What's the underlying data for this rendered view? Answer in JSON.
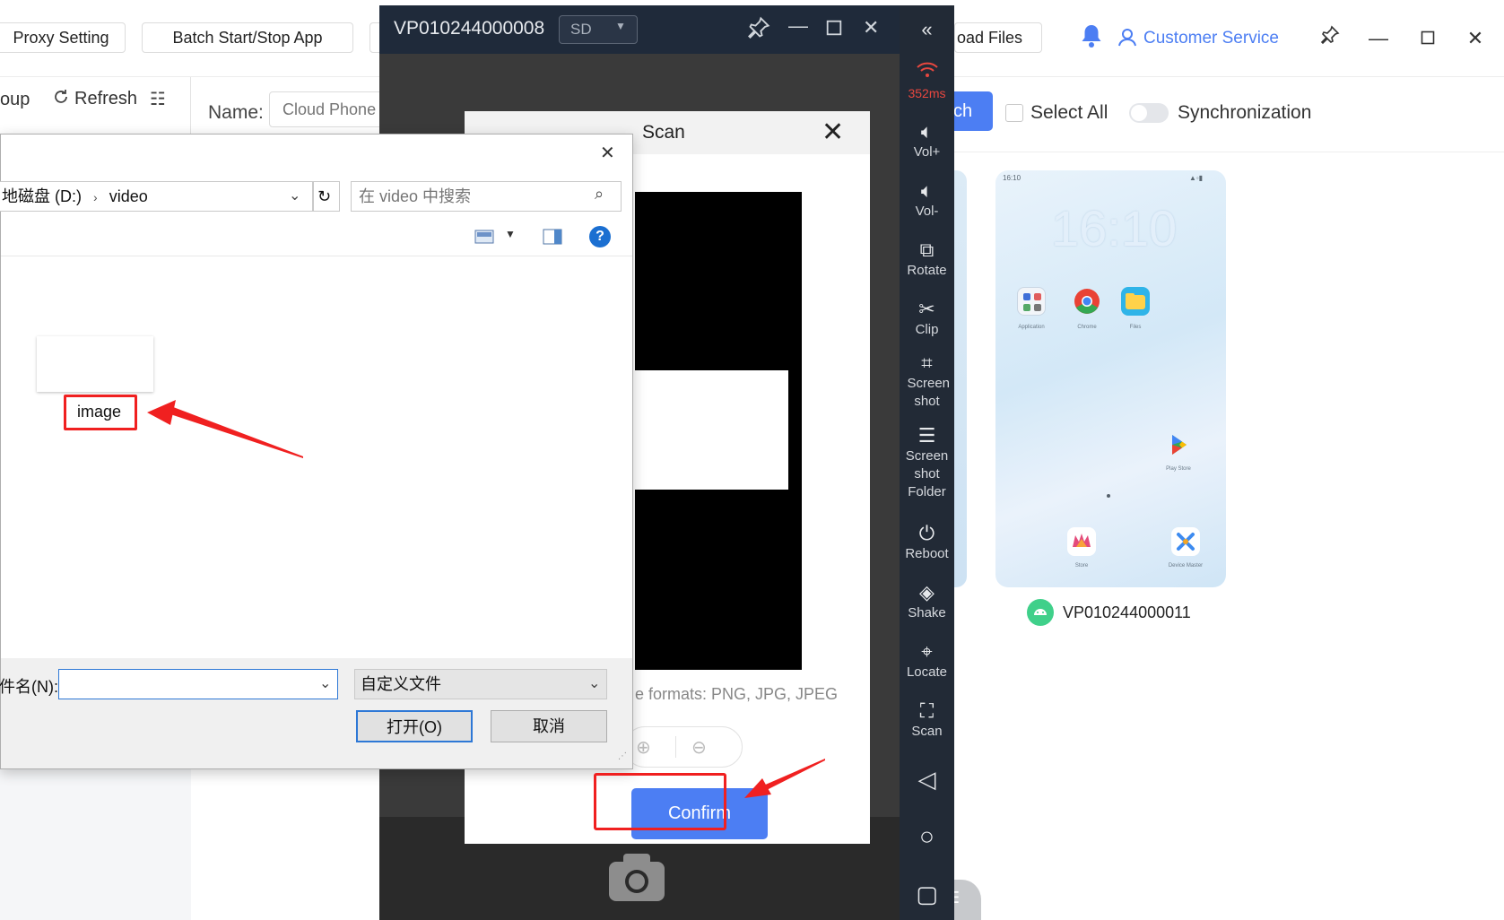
{
  "topbar": {
    "proxy_setting": "Proxy Setting",
    "batch_start_stop": "Batch Start/Stop App",
    "upload_files_partial": "oad Files",
    "customer_service": "Customer Service"
  },
  "toolbar": {
    "group_partial": "oup",
    "refresh": "Refresh",
    "name_label": "Name:",
    "name_placeholder": "Cloud Phone",
    "search_partial": "ch",
    "select_all": "Select All",
    "synchronization": "Synchronization"
  },
  "thumb": {
    "time_small": "16:10",
    "clock": "16:10",
    "apps": [
      "Application",
      "Chrome",
      "Files",
      "Play Store",
      "Store",
      "Device Master"
    ],
    "device_name": "VP010244000011"
  },
  "phone_window": {
    "title": "VP010244000008",
    "quality": "SD",
    "latency": "352ms",
    "sidebar": [
      "Vol+",
      "Vol-",
      "Rotate",
      "Clip",
      "Screen shot",
      "Screen shot Folder",
      "Reboot",
      "Shake",
      "Locate",
      "Scan"
    ]
  },
  "scan_dialog": {
    "title": "Scan",
    "formats_partial": "e formats: PNG, JPG, JPEG",
    "confirm": "Confirm"
  },
  "file_dialog": {
    "path_drive": "地磁盘 (D:)",
    "path_folder": "video",
    "search_placeholder": "在 video 中搜索",
    "file_name": "image",
    "filename_label": "件名(N):",
    "filename_value": "",
    "filetype": "自定义文件",
    "open_button": "打开(O)",
    "cancel_button": "取消"
  },
  "colors": {
    "accent": "#4c7ef3",
    "annotation_red": "#f02020",
    "phone_sidebar": "#222a36"
  }
}
